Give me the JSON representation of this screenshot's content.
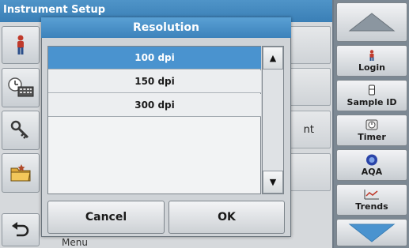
{
  "background": {
    "header_title": "Instrument Setup",
    "item_partial_text": "nt",
    "bottom_partial_text": "Menu"
  },
  "left_icons": [
    "operator-icon",
    "clock-keyboard-icon",
    "key-icon",
    "folder-icon",
    "back-arrow-icon"
  ],
  "right_panel": {
    "buttons": [
      {
        "label": "Login",
        "icon": "person-icon"
      },
      {
        "label": "Sample ID",
        "icon": "flask-icon"
      },
      {
        "label": "Timer",
        "icon": "timer-icon"
      },
      {
        "label": "AQA",
        "icon": "aqa-icon"
      },
      {
        "label": "Trends",
        "icon": "trends-icon"
      }
    ]
  },
  "dialog": {
    "title": "Resolution",
    "options": [
      {
        "label": "100 dpi",
        "selected": true
      },
      {
        "label": "150 dpi",
        "selected": false
      },
      {
        "label": "300 dpi",
        "selected": false
      }
    ],
    "cancel_label": "Cancel",
    "ok_label": "OK"
  },
  "colors": {
    "accent": "#4a93cf",
    "header": "#3a7fb6"
  }
}
